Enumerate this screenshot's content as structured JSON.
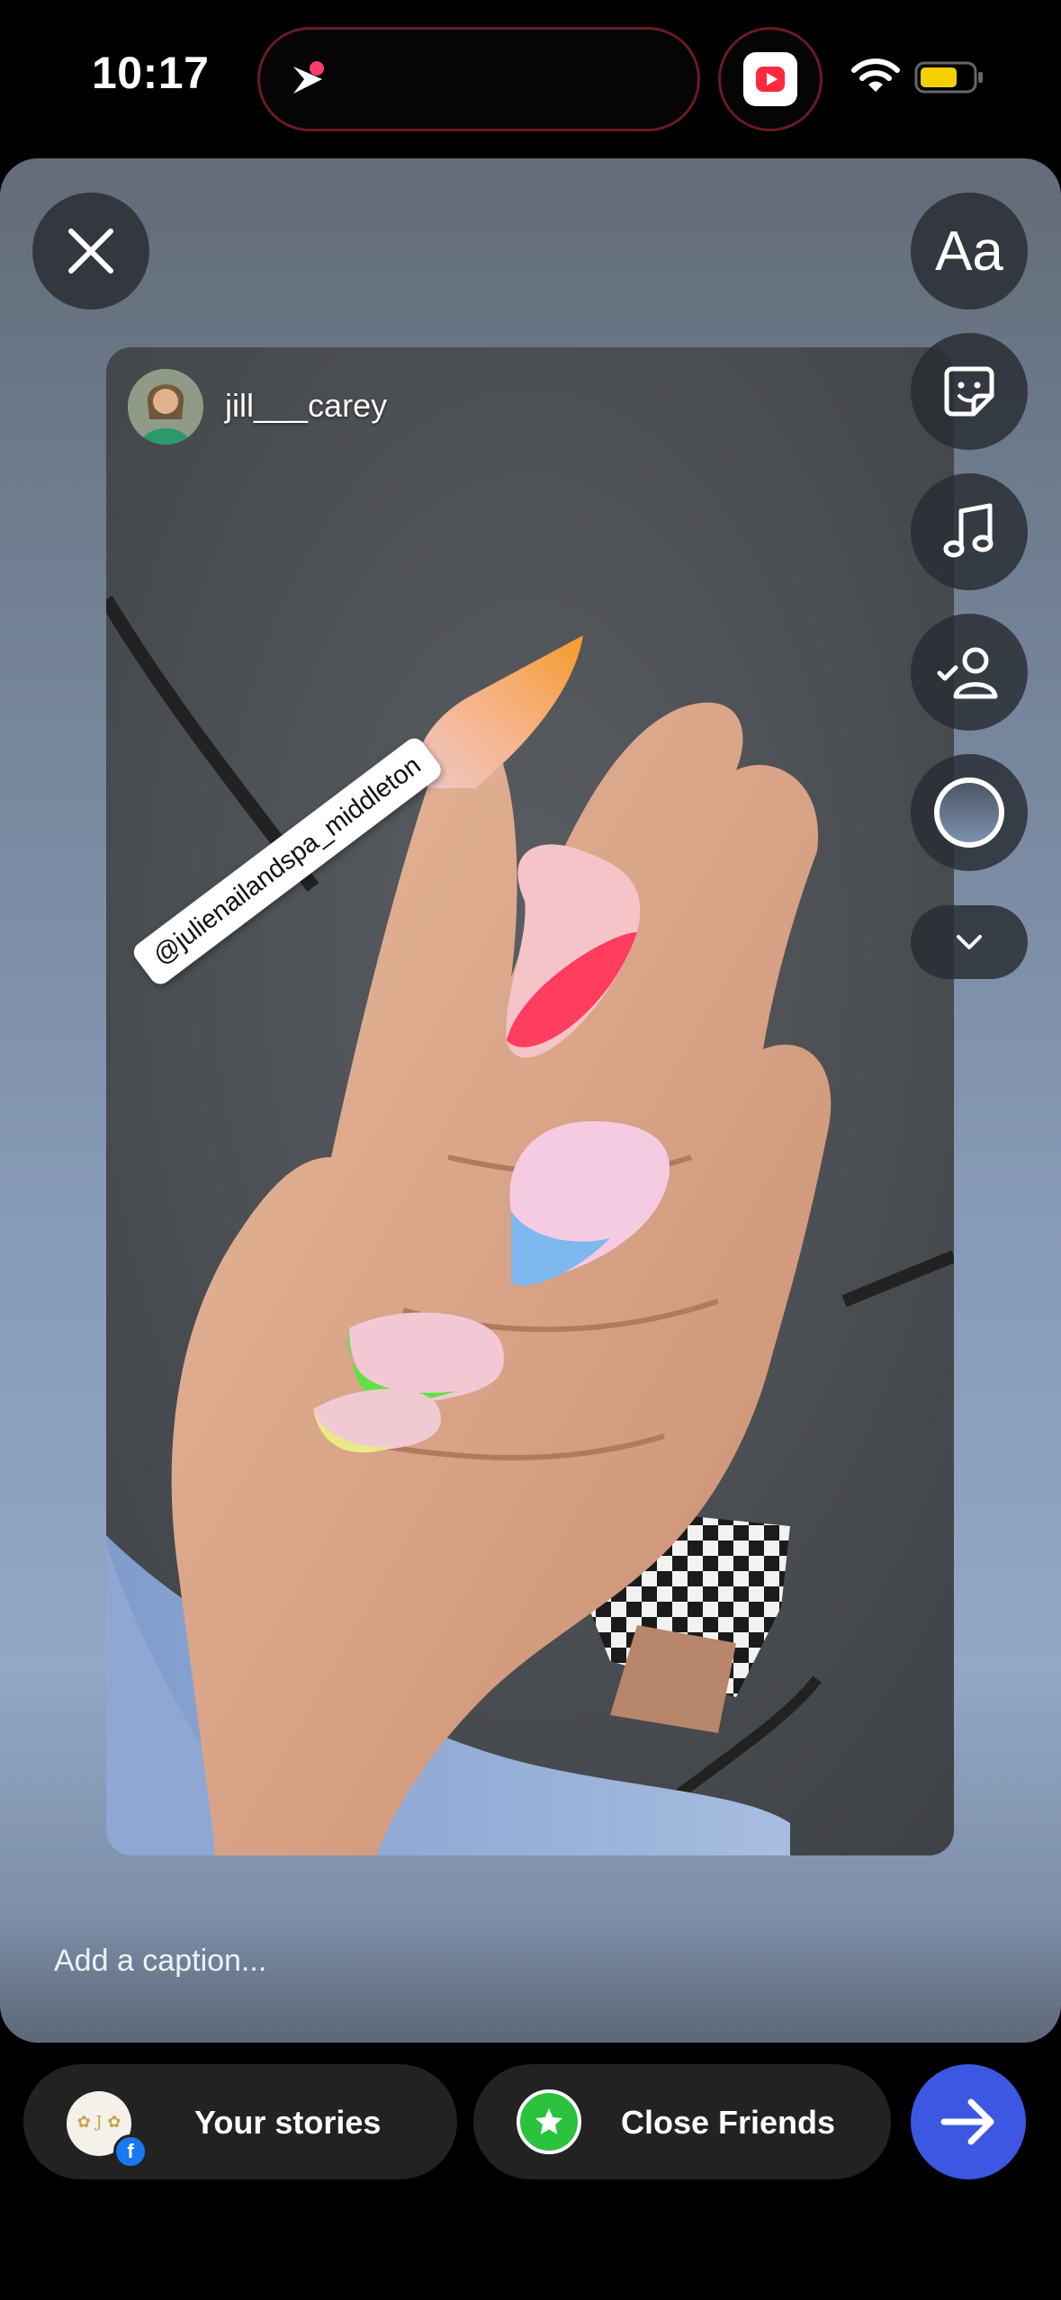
{
  "status_bar": {
    "time": "10:17",
    "icons": [
      "live-activity-logo",
      "media-app-icon",
      "wifi-icon",
      "battery-icon"
    ],
    "battery_color": "#f5d000"
  },
  "editor": {
    "close_icon": "close-icon",
    "tools": [
      {
        "name": "text",
        "label": "Aa"
      },
      {
        "name": "sticker",
        "icon": "sticker-icon"
      },
      {
        "name": "music",
        "icon": "music-note-icon"
      },
      {
        "name": "mention",
        "icon": "mention-person-icon"
      },
      {
        "name": "effects",
        "icon": "circle-icon"
      },
      {
        "name": "more",
        "icon": "chevron-down-icon"
      }
    ]
  },
  "shared_post": {
    "author": "jill___carey",
    "mention_sticker": "@julienailandspa_middleton"
  },
  "caption": {
    "placeholder": "Add a caption..."
  },
  "share_bar": {
    "your_stories_label": "Your stories",
    "close_friends_label": "Close Friends",
    "close_friends_color": "#2bc33e",
    "send_color": "#3d57e3"
  }
}
